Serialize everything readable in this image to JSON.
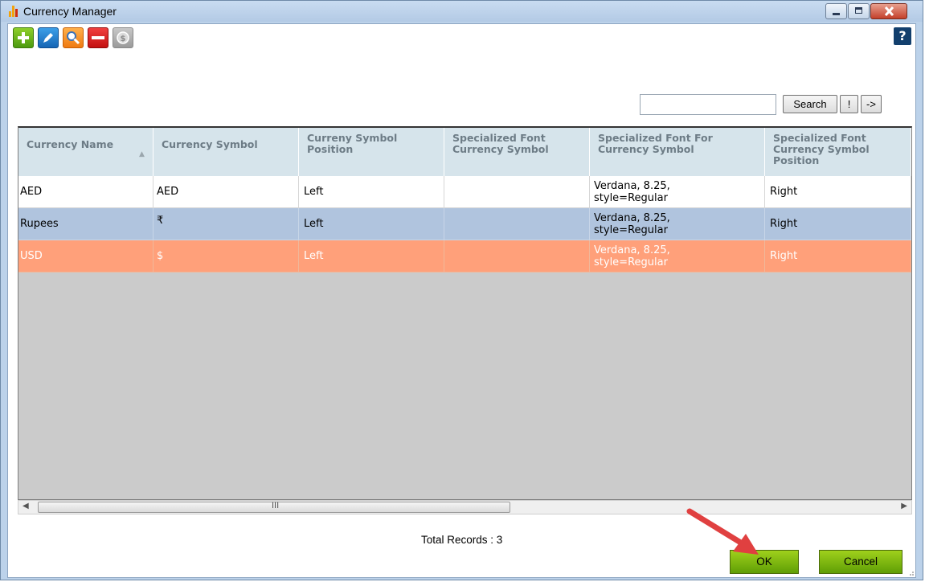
{
  "window": {
    "title": "Currency Manager"
  },
  "toolbar": {
    "add_icon": "plus-icon",
    "edit_icon": "pencil-icon",
    "view_icon": "magnifier-icon",
    "delete_icon": "minus-icon",
    "currency_icon": "dollar-coin-icon",
    "help_label": "?"
  },
  "search": {
    "value": "",
    "placeholder": "",
    "search_label": "Search",
    "clear_label": "!",
    "next_label": "->"
  },
  "grid": {
    "columns": [
      "Currency Name",
      "Currency Symbol",
      "Curreny Symbol Position",
      "Specialized Font Currency Symbol",
      "Specialized Font For Currency Symbol",
      "Specialized Font Currency Symbol Position"
    ],
    "rows": [
      [
        "AED",
        "AED",
        "Left",
        "",
        "Verdana, 8.25, style=Regular",
        "Right"
      ],
      [
        "Rupees",
        "₹",
        "Left",
        "",
        "Verdana, 8.25, style=Regular",
        "Right"
      ],
      [
        "USD",
        "$",
        "Left",
        "",
        "Verdana, 8.25, style=Regular",
        "Right"
      ]
    ],
    "sorted_column": "Currency Name",
    "sort_direction": "ascending"
  },
  "scrollbar": {
    "grip": "III"
  },
  "footer": {
    "total_records": "Total Records : 3",
    "ok_label": "OK",
    "cancel_label": "Cancel"
  },
  "colors": {
    "header_bg": "#d6e4eb",
    "row_normal": "#ffffff",
    "row_alt": "#b0c4de",
    "row_selected": "#ffa07a",
    "button_green": "#7fc20f",
    "annotation_arrow": "#e04040"
  }
}
